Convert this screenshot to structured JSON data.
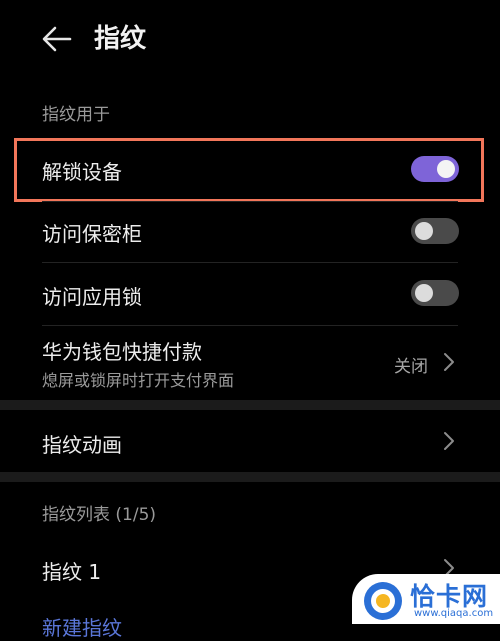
{
  "header": {
    "title": "指纹",
    "back_icon": "arrow-left-icon"
  },
  "sections": {
    "use_for": "指纹用于",
    "list": "指纹列表 (1/5)"
  },
  "rows": {
    "unlock": {
      "label": "解锁设备",
      "toggle": "on"
    },
    "safe": {
      "label": "访问保密柜",
      "toggle": "off"
    },
    "applock": {
      "label": "访问应用锁",
      "toggle": "off"
    },
    "wallet": {
      "label": "华为钱包快捷付款",
      "sub": "熄屏或锁屏时打开支付界面",
      "value": "关闭"
    },
    "animation": {
      "label": "指纹动画"
    },
    "fp1": {
      "label": "指纹 1"
    },
    "new": {
      "label": "新建指纹"
    }
  },
  "watermark": {
    "text": "恰卡网",
    "url": "www.qiaqa.com"
  },
  "colors": {
    "accent": "#7e64d8",
    "highlight": "#f2765a",
    "watermark": "#2a6fd6"
  }
}
